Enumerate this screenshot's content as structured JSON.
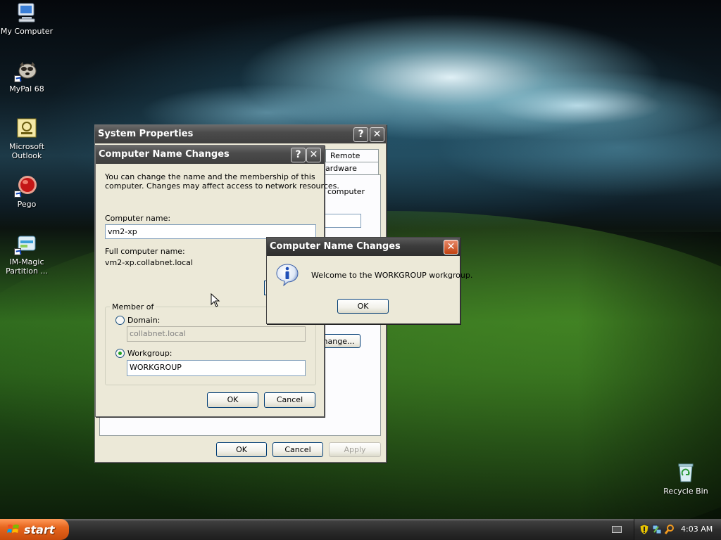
{
  "desktop": {
    "icons": [
      {
        "label": "My Computer",
        "icon": "my-computer-icon"
      },
      {
        "label": "MyPal 68",
        "icon": "mypal-browser-icon"
      },
      {
        "label": "Microsoft Outlook",
        "icon": "outlook-icon"
      },
      {
        "label": "Pego",
        "icon": "pego-icon"
      },
      {
        "label": "IM-Magic Partition ...",
        "icon": "partition-tool-icon"
      },
      {
        "label": "Recycle Bin",
        "icon": "recycle-bin-icon"
      }
    ]
  },
  "system_properties": {
    "title": "System Properties",
    "tabs": [
      "Remote",
      "ardware"
    ],
    "partial_text": "computer",
    "change_button": "hange...",
    "ok": "OK",
    "cancel": "Cancel",
    "apply": "Apply"
  },
  "computer_name_changes": {
    "title": "Computer Name Changes",
    "description": "You can change the name and the membership of this computer. Changes may affect access to network resources.",
    "description_line1": "You can change the name and the membership of this",
    "description_line2": "computer. Changes may affect access to network resources.",
    "computer_name_label": "Computer name:",
    "computer_name_value": "vm2-xp",
    "full_name_label": "Full computer name:",
    "full_name_value": "vm2-xp.collabnet.local",
    "member_of_label": "Member of",
    "domain_label": "Domain:",
    "domain_value": "collabnet.local",
    "workgroup_label": "Workgroup:",
    "workgroup_value": "WORKGROUP",
    "selected_membership": "Workgroup",
    "ok": "OK",
    "cancel": "Cancel"
  },
  "welcome_dialog": {
    "title": "Computer Name Changes",
    "message": "Welcome to the WORKGROUP workgroup.",
    "ok": "OK",
    "icon": "information-icon"
  },
  "taskbar": {
    "start_label": "start",
    "clock": "4:03 AM",
    "tray_icons": [
      "keyboard-icon",
      "security-shield-icon",
      "network-icon",
      "search-icon"
    ]
  }
}
